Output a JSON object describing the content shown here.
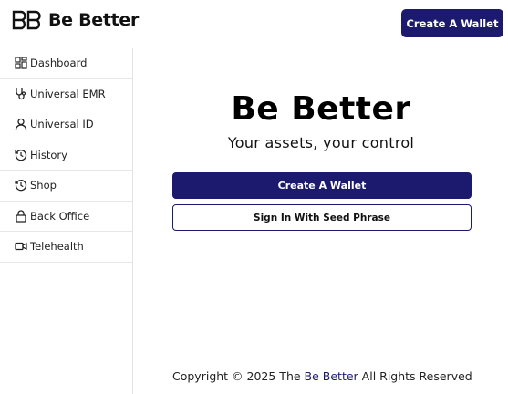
{
  "header": {
    "logo_icon": "be-better-logo-icon",
    "logo_text": "Be Better",
    "create_wallet_label": "Create A Wallet"
  },
  "sidebar": {
    "items": [
      {
        "label": "Dashboard",
        "icon": "dashboard-grid-icon"
      },
      {
        "label": "Universal EMR",
        "icon": "stethoscope-icon"
      },
      {
        "label": "Universal ID",
        "icon": "user-icon"
      },
      {
        "label": "History",
        "icon": "history-clock-icon"
      },
      {
        "label": "Shop",
        "icon": "history-clock-icon"
      },
      {
        "label": "Back Office",
        "icon": "lock-icon"
      },
      {
        "label": "Telehealth",
        "icon": "video-camera-icon"
      }
    ]
  },
  "main": {
    "title": "Be Better",
    "tagline": "Your assets, your control",
    "create_wallet_label": "Create A Wallet",
    "seed_signin_label": "Sign In With Seed Phrase"
  },
  "footer": {
    "prefix": "Copyright © 2025 The",
    "link": "Be Better",
    "suffix": "All Rights Reserved"
  },
  "colors": {
    "brand": "#1b1a6e",
    "border": "#e3e3e3",
    "text": "#111111"
  }
}
